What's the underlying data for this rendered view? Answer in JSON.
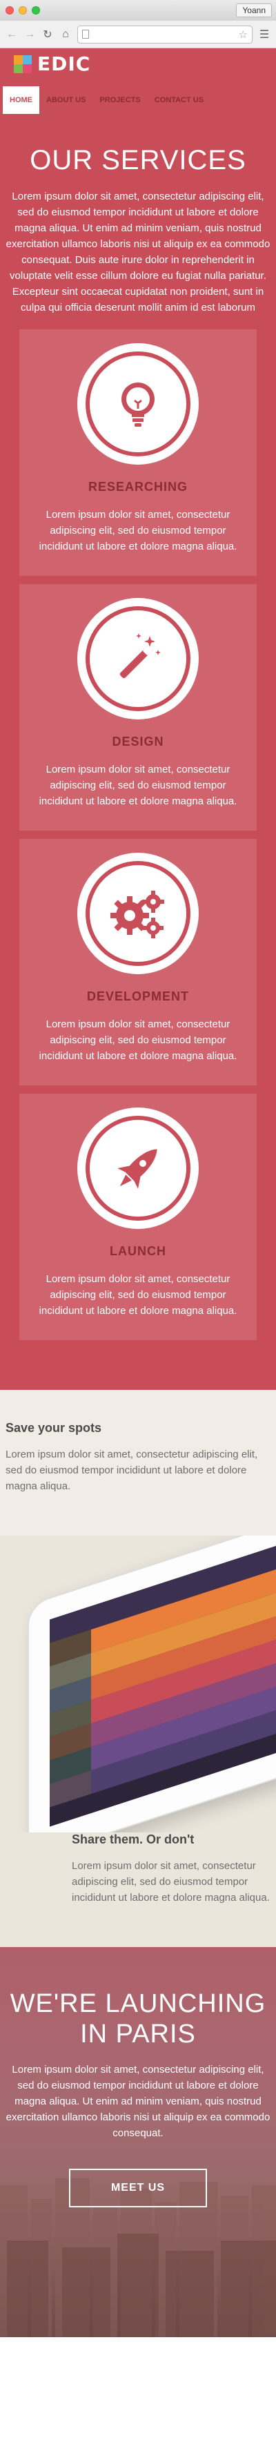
{
  "browser": {
    "user_label": "Yoann"
  },
  "header": {
    "logo_text": "EDIC",
    "nav": [
      {
        "label": "HOME"
      },
      {
        "label": "ABOUT US"
      },
      {
        "label": "PROJECTS"
      },
      {
        "label": "CONTACT US"
      }
    ]
  },
  "services": {
    "title": "OUR SERVICES",
    "intro": "Lorem ipsum dolor sit amet, consectetur adipiscing elit, sed do eiusmod tempor incididunt ut labore et dolore magna aliqua. Ut enim ad minim veniam, quis nostrud exercitation ullamco laboris nisi ut aliquip ex ea commodo consequat. Duis aute irure dolor in reprehenderit in voluptate velit esse cillum dolore eu fugiat nulla pariatur. Excepteur sint occaecat cupidatat non proident, sunt in culpa qui officia deserunt mollit anim id est laborum",
    "cards": [
      {
        "title": "RESEARCHING",
        "text": "Lorem ipsum dolor sit amet, consectetur adipiscing elit, sed do eiusmod tempor incididunt ut labore et dolore magna aliqua.",
        "icon": "lightbulb-icon"
      },
      {
        "title": "DESIGN",
        "text": "Lorem ipsum dolor sit amet, consectetur adipiscing elit, sed do eiusmod tempor incididunt ut labore et dolore magna aliqua.",
        "icon": "magic-wand-icon"
      },
      {
        "title": "DEVELOPMENT",
        "text": "Lorem ipsum dolor sit amet, consectetur adipiscing elit, sed do eiusmod tempor incididunt ut labore et dolore magna aliqua.",
        "icon": "gears-icon"
      },
      {
        "title": "LAUNCH",
        "text": "Lorem ipsum dolor sit amet, consectetur adipiscing elit, sed do eiusmod tempor incididunt ut labore et dolore magna aliqua.",
        "icon": "rocket-icon"
      }
    ]
  },
  "spots": {
    "title": "Save your spots",
    "text": "Lorem ipsum dolor sit amet, consectetur adipiscing elit, sed do eiusmod tempor incididunt ut labore et dolore magna aliqua."
  },
  "share": {
    "title": "Share them. Or don't",
    "text": "Lorem ipsum dolor sit amet, consectetur adipiscing elit, sed do eiusmod tempor incididunt ut labore et dolore magna aliqua."
  },
  "paris": {
    "title_line1": "WE'RE LAUNCHING",
    "title_line2": "IN PARIS",
    "text": "Lorem ipsum dolor sit amet, consectetur adipiscing elit, sed do eiusmod tempor incididunt ut labore et dolore magna aliqua. Ut enim ad minim veniam, quis nostrud exercitation ullamco laboris nisi ut aliquip ex ea commodo consequat.",
    "button_label": "MEET US"
  },
  "colors": {
    "brand": "#c94d59",
    "card": "#d0646e",
    "nav_text": "#8a2c36",
    "spots_bg": "#f1ede6"
  }
}
